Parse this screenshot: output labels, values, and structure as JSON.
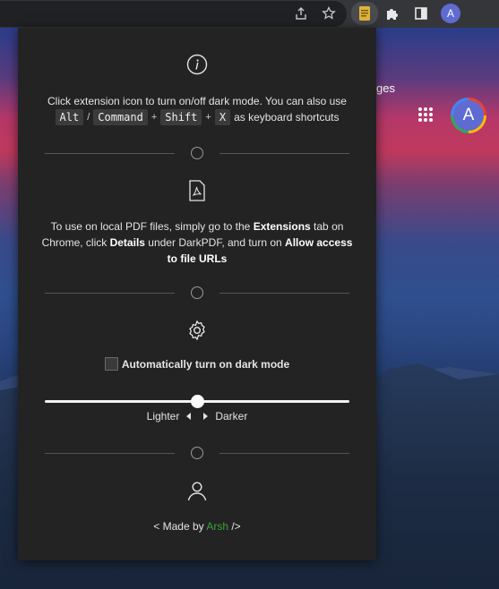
{
  "browser": {
    "avatar_letter": "A",
    "icons": [
      "share-icon",
      "star-icon",
      "extension-darkpdf-icon",
      "puzzle-icon",
      "sidebar-icon"
    ]
  },
  "page": {
    "link_text": "ges",
    "avatar_letter": "A"
  },
  "popup": {
    "intro": {
      "text": "Click extension icon to turn on/off dark mode. You can also use",
      "keys": [
        "Alt",
        "/",
        "Command",
        "+",
        "Shift",
        "+",
        "X"
      ],
      "suffix": "as keyboard shortcuts"
    },
    "pdf": {
      "part1": "To use on local PDF files, simply go to the ",
      "bold1": "Extensions",
      "part2": " tab on Chrome, click ",
      "bold2": "Details",
      "part3": " under DarkPDF, and turn on ",
      "bold3": "Allow access to file URLs"
    },
    "auto_dark_label": "Automatically turn on dark mode",
    "auto_dark_checked": false,
    "slider": {
      "value_fraction": 0.5,
      "left_label": "Lighter",
      "right_label": "Darker"
    },
    "credit": {
      "prefix": "< Made by ",
      "author": "Arsh",
      "suffix": " />"
    },
    "colors": {
      "popup_bg": "#232323",
      "author_link": "#3da535"
    }
  }
}
